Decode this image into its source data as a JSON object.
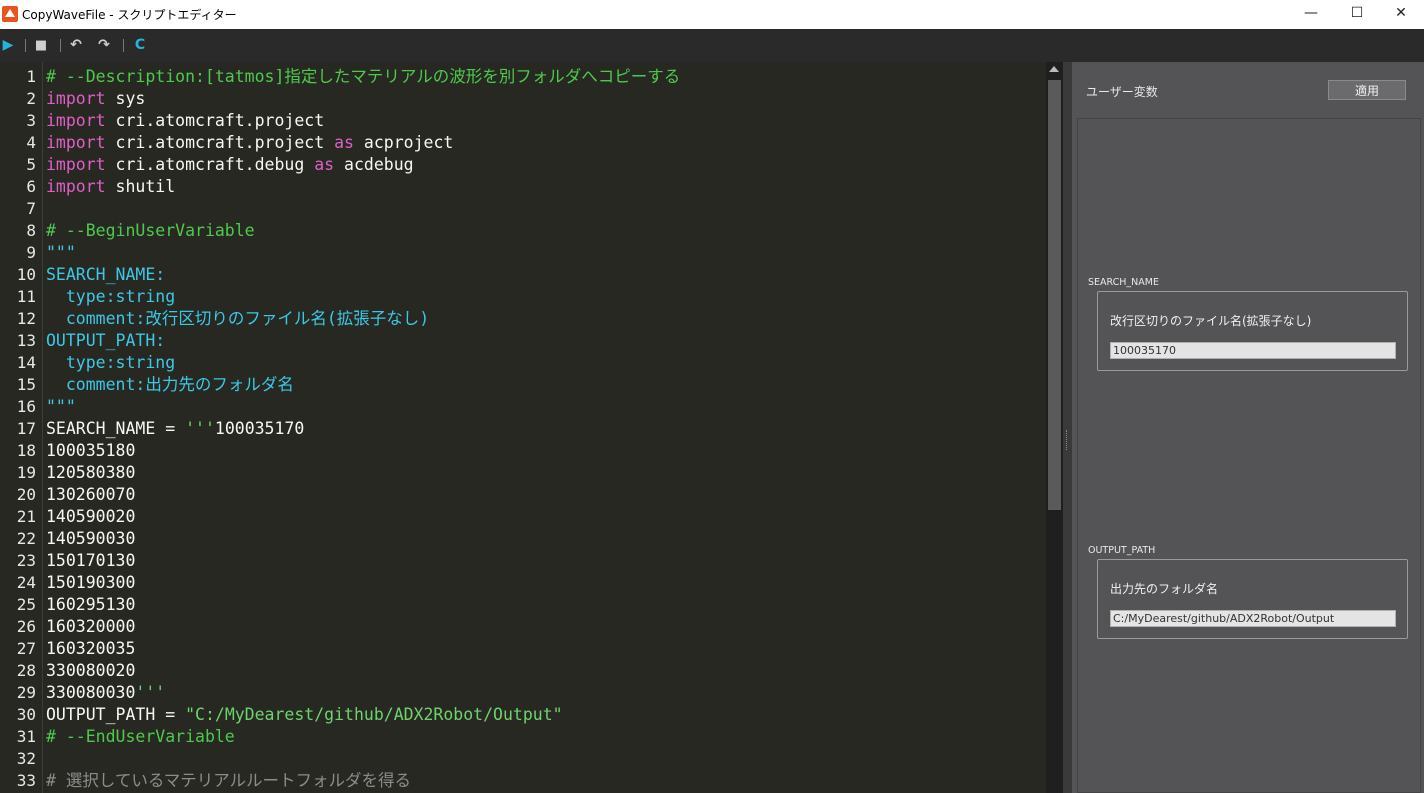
{
  "window": {
    "title": "CopyWaveFile - スクリプトエディター",
    "controls": {
      "minimize": "—",
      "maximize": "☐",
      "close": "✕"
    }
  },
  "toolbar": {
    "icons": [
      "run-icon",
      "save-icon",
      "undo-icon",
      "redo-icon",
      "reload-icon"
    ],
    "glyphs": {
      "run": "▶",
      "save": "■",
      "undo": "↶",
      "redo": "↷",
      "reload": "C"
    }
  },
  "editor": {
    "line_numbers": [
      "1",
      "2",
      "3",
      "4",
      "5",
      "6",
      "7",
      "8",
      "9",
      "10",
      "11",
      "12",
      "13",
      "14",
      "15",
      "16",
      "17",
      "18",
      "19",
      "20",
      "21",
      "22",
      "23",
      "24",
      "25",
      "26",
      "27",
      "28",
      "29",
      "30",
      "31",
      "32",
      "33"
    ],
    "lines": [
      [
        {
          "t": "# --Description:[tatmos]指定したマテリアルの波形を別フォルダへコピーする",
          "c": "comment"
        }
      ],
      [
        {
          "t": "import",
          "c": "kw"
        },
        {
          "t": " sys",
          "c": "plain"
        }
      ],
      [
        {
          "t": "import",
          "c": "kw"
        },
        {
          "t": " cri.atomcraft.project",
          "c": "plain"
        }
      ],
      [
        {
          "t": "import",
          "c": "kw"
        },
        {
          "t": " cri.atomcraft.project ",
          "c": "plain"
        },
        {
          "t": "as",
          "c": "kw"
        },
        {
          "t": " acproject",
          "c": "plain"
        }
      ],
      [
        {
          "t": "import",
          "c": "kw"
        },
        {
          "t": " cri.atomcraft.debug ",
          "c": "plain"
        },
        {
          "t": "as",
          "c": "kw"
        },
        {
          "t": " acdebug",
          "c": "plain"
        }
      ],
      [
        {
          "t": "import",
          "c": "kw"
        },
        {
          "t": " shutil",
          "c": "plain"
        }
      ],
      [],
      [
        {
          "t": "# --BeginUserVariable",
          "c": "comment"
        }
      ],
      [
        {
          "t": "\"\"\"",
          "c": "doc"
        }
      ],
      [
        {
          "t": "SEARCH_NAME:",
          "c": "doc"
        }
      ],
      [
        {
          "t": "  type:string",
          "c": "doc"
        }
      ],
      [
        {
          "t": "  comment:改行区切りのファイル名(拡張子なし)",
          "c": "doc"
        }
      ],
      [
        {
          "t": "OUTPUT_PATH:",
          "c": "doc"
        }
      ],
      [
        {
          "t": "  type:string",
          "c": "doc"
        }
      ],
      [
        {
          "t": "  comment:出力先のフォルダ名",
          "c": "doc"
        }
      ],
      [
        {
          "t": "\"\"\"",
          "c": "doc"
        }
      ],
      [
        {
          "t": "SEARCH_NAME = ",
          "c": "plain"
        },
        {
          "t": "'''",
          "c": "str"
        },
        {
          "t": "100035170",
          "c": "plain"
        }
      ],
      [
        {
          "t": "100035180",
          "c": "plain"
        }
      ],
      [
        {
          "t": "120580380",
          "c": "plain"
        }
      ],
      [
        {
          "t": "130260070",
          "c": "plain"
        }
      ],
      [
        {
          "t": "140590020",
          "c": "plain"
        }
      ],
      [
        {
          "t": "140590030",
          "c": "plain"
        }
      ],
      [
        {
          "t": "150170130",
          "c": "plain"
        }
      ],
      [
        {
          "t": "150190300",
          "c": "plain"
        }
      ],
      [
        {
          "t": "160295130",
          "c": "plain"
        }
      ],
      [
        {
          "t": "160320000",
          "c": "plain"
        }
      ],
      [
        {
          "t": "160320035",
          "c": "plain"
        }
      ],
      [
        {
          "t": "330080020",
          "c": "plain"
        }
      ],
      [
        {
          "t": "330080030",
          "c": "plain"
        },
        {
          "t": "'''",
          "c": "str"
        }
      ],
      [
        {
          "t": "OUTPUT_PATH = ",
          "c": "plain"
        },
        {
          "t": "\"C:/MyDearest/github/ADX2Robot/Output\"",
          "c": "str"
        }
      ],
      [
        {
          "t": "# --EndUserVariable",
          "c": "comment"
        }
      ],
      [],
      [
        {
          "t": "# 選択しているマテリアルルートフォルダを得る",
          "c": "dim"
        }
      ]
    ]
  },
  "user_vars": {
    "title": "ユーザー変数",
    "apply_label": "適用",
    "search": {
      "name": "SEARCH_NAME",
      "comment": "改行区切りのファイル名(拡張子なし)",
      "value": "100035170"
    },
    "output": {
      "name": "OUTPUT_PATH",
      "comment": "出力先のフォルダ名",
      "value": "C:/MyDearest/github/ADX2Robot/Output"
    }
  },
  "colors": {
    "editor_bg": "#272822",
    "comment": "#4ec94e",
    "keyword": "#e05ec7",
    "docstring": "#3cc8e6",
    "string": "#6dd36d",
    "panel_bg": "#545457"
  }
}
